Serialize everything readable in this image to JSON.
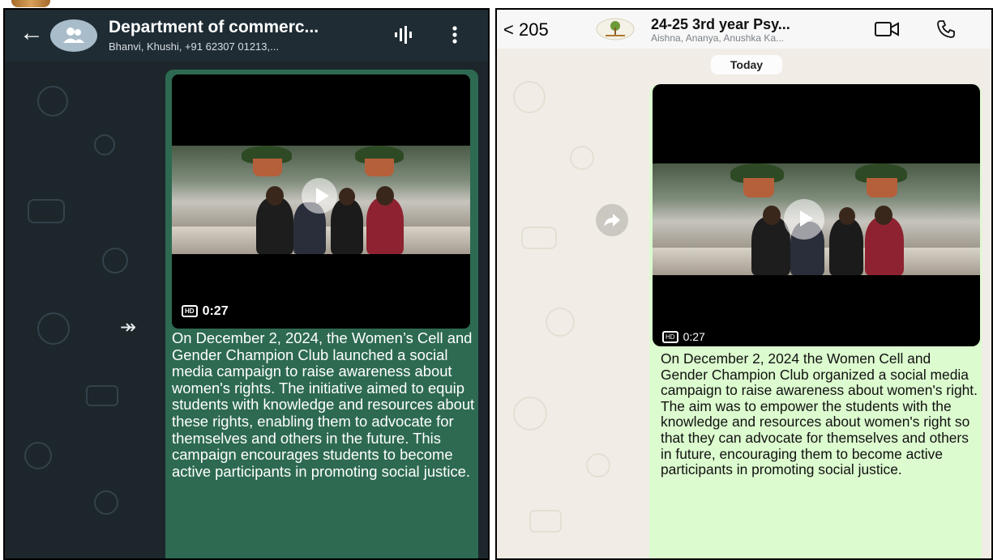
{
  "left_chat": {
    "header": {
      "title": "Department of commerc...",
      "subtitle": "Bhanvi, Khushi, +91 62307 01213,..."
    },
    "video": {
      "quality_badge": "HD",
      "duration": "0:27"
    },
    "message_text": "On December 2, 2024, the Women’s Cell and Gender Champion Club launched a social media campaign to raise awareness about women's rights. The initiative aimed to equip students with knowledge and resources about these rights, enabling them to advocate for themselves and others in the future. This campaign encourages students to become active participants in promoting social justice.",
    "colors": {
      "header": "#1f2c34",
      "bubble": "#2d6a51",
      "background": "#1c262b"
    }
  },
  "right_chat": {
    "header": {
      "back_count": "205",
      "title": "24-25 3rd year Psy...",
      "subtitle": "Aishna, Ananya, Anushka Ka..."
    },
    "date_divider": "Today",
    "video": {
      "quality_badge": "HD",
      "duration": "0:27"
    },
    "message_text": "On December 2, 2024 the Women Cell and Gender Champion Club organized a social media campaign to raise awareness about women's right. The aim was to empower the students with the knowledge and resources about women's right so that they can advocate for themselves and others in future, encouraging them to become active participants in promoting social justice.",
    "colors": {
      "header": "#f7f7f7",
      "bubble": "#dcfbcf",
      "background": "#f1ede6"
    }
  }
}
